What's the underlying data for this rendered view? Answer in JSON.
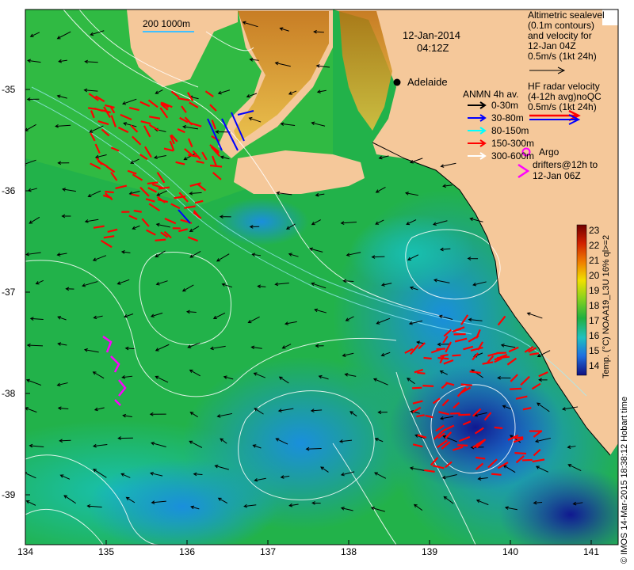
{
  "map": {
    "date": "12-Jan-2014",
    "time": "04:12Z",
    "scale_bar": "200  1000m",
    "city": "Adelaide",
    "x_ticks": [
      "134",
      "135",
      "136",
      "137",
      "138",
      "139",
      "140",
      "141"
    ],
    "y_ticks": [
      "-35",
      "-36",
      "-37",
      "-38",
      "-39"
    ]
  },
  "legend": {
    "altimetric": [
      "Altimetric sealevel",
      "(0.1m contours)",
      "and velocity for",
      "12-Jan 04Z",
      "0.5m/s (1kt 24h)"
    ],
    "hf_radar": [
      "HF radar velocity",
      "(4-12h avg)noQC",
      "0.5m/s (1kt 24h)"
    ],
    "anmn_title": "ANMN 4h av.",
    "anmn_items": [
      {
        "label": "0-30m",
        "color": "#000000"
      },
      {
        "label": "30-80m",
        "color": "#0000ff"
      },
      {
        "label": "80-150m",
        "color": "#00ffff"
      },
      {
        "label": "150-300m",
        "color": "#ff0000"
      },
      {
        "label": "300-600m",
        "color": "#ffffff"
      }
    ],
    "argo": [
      "Argo",
      "drifters@12h to",
      "12-Jan 06Z"
    ]
  },
  "colorbar": {
    "ticks": [
      "23",
      "22",
      "21",
      "20",
      "19",
      "18",
      "17",
      "16",
      "15",
      "14"
    ],
    "label": "Temp. (°C) NOAA19_L3U 16% ql>=2"
  },
  "credit": "© IMOS 14-Mar-2015 18:38:12 Hobart time",
  "colors": {
    "land": "#f5c89a",
    "sea_green": "#22b24a",
    "sea_blue": "#2299dd",
    "deep_blue": "#10109a",
    "red_arrow": "#ff0000",
    "argo": "#ff00ff"
  }
}
